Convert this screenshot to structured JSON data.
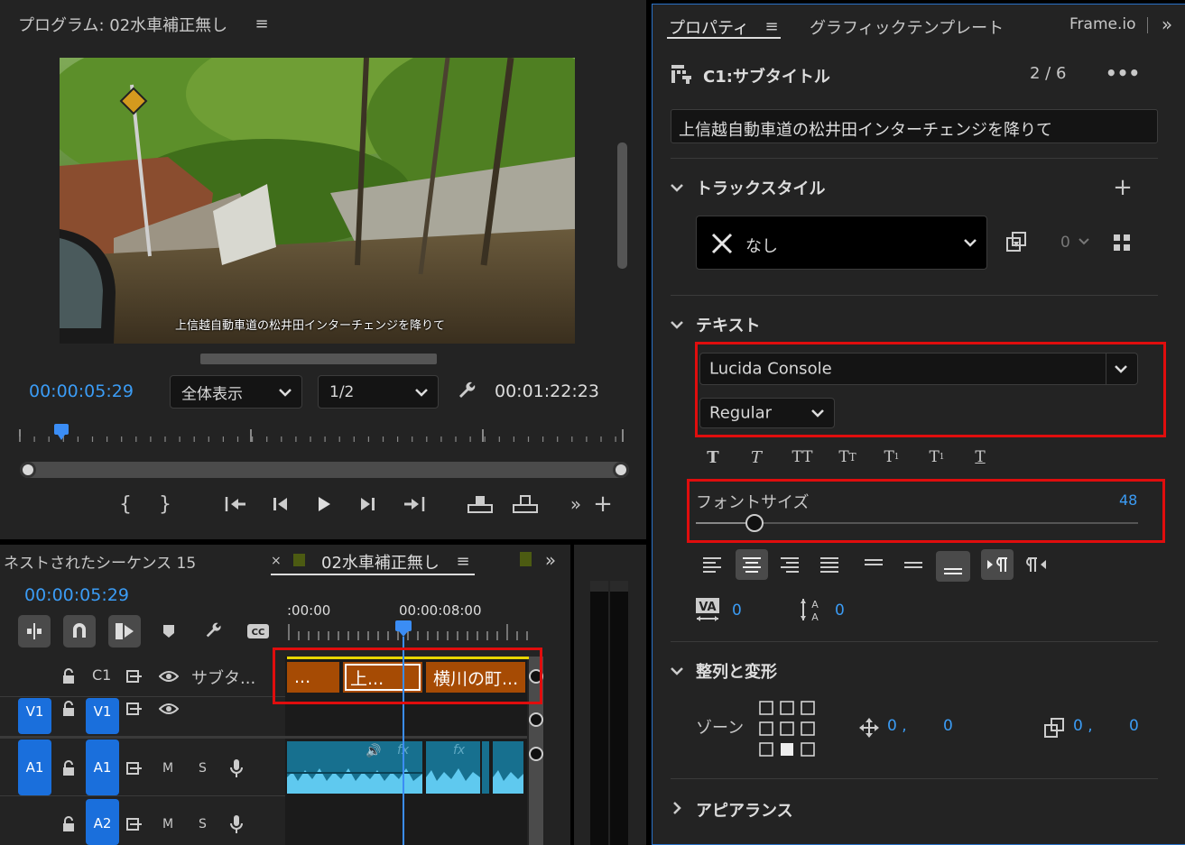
{
  "program_monitor": {
    "title": "プログラム: 02水車補正無し",
    "video_subtitle": "上信越自動車道の松井田インターチェンジを降りて",
    "current_timecode": "00:00:05:29",
    "zoom_select": "全体表示",
    "resolution_select": "1/2",
    "duration_timecode": "00:01:22:23"
  },
  "properties_panel": {
    "tabs": [
      "プロパティ",
      "グラフィックテンプレート",
      "Frame.io"
    ],
    "clip_name": "C1:サブタイトル",
    "clip_counter": "2 / 6",
    "caption_text": "上信越自動車道の松井田インターチェンジを降りて",
    "track_style_heading": "トラックスタイル",
    "track_style_value": "なし",
    "track_style_count": "0",
    "text_heading": "テキスト",
    "font_family": "Lucida Console",
    "font_style": "Regular",
    "font_size_label": "フォントサイズ",
    "font_size_value": "48",
    "font_size_fraction": 0.05,
    "kerning_value": "0",
    "leading_value": "0",
    "align_heading": "整列と変形",
    "zone_label": "ゾーン",
    "position_x": "0 ,",
    "position_y": "0",
    "anchor_x": "0 ,",
    "anchor_y": "0",
    "appearance_heading": "アピアランス"
  },
  "timeline": {
    "left_tab": "ネストされたシーケンス 15",
    "active_tab": "02水車補正無し",
    "timecode": "00:00:05:29",
    "ruler_labels": [
      ":00:00",
      "00:00:08:00"
    ],
    "tracks": {
      "c1_label": "C1",
      "c1_name": "サブタ...",
      "v1_left": "V1",
      "v1_right": "V1",
      "a1_left": "A1",
      "a1_right": "A1",
      "a2_right": "A2",
      "m_label": "M",
      "s_label": "S"
    },
    "caption_clips": [
      "...",
      "上...",
      "横川の町..."
    ],
    "fx_label": "fx"
  },
  "colors": {
    "accent_blue": "#3b9cf5",
    "highlight_red": "#e00d0d",
    "caption_clip": "#a64b04",
    "audio_clip": "#17708f"
  }
}
